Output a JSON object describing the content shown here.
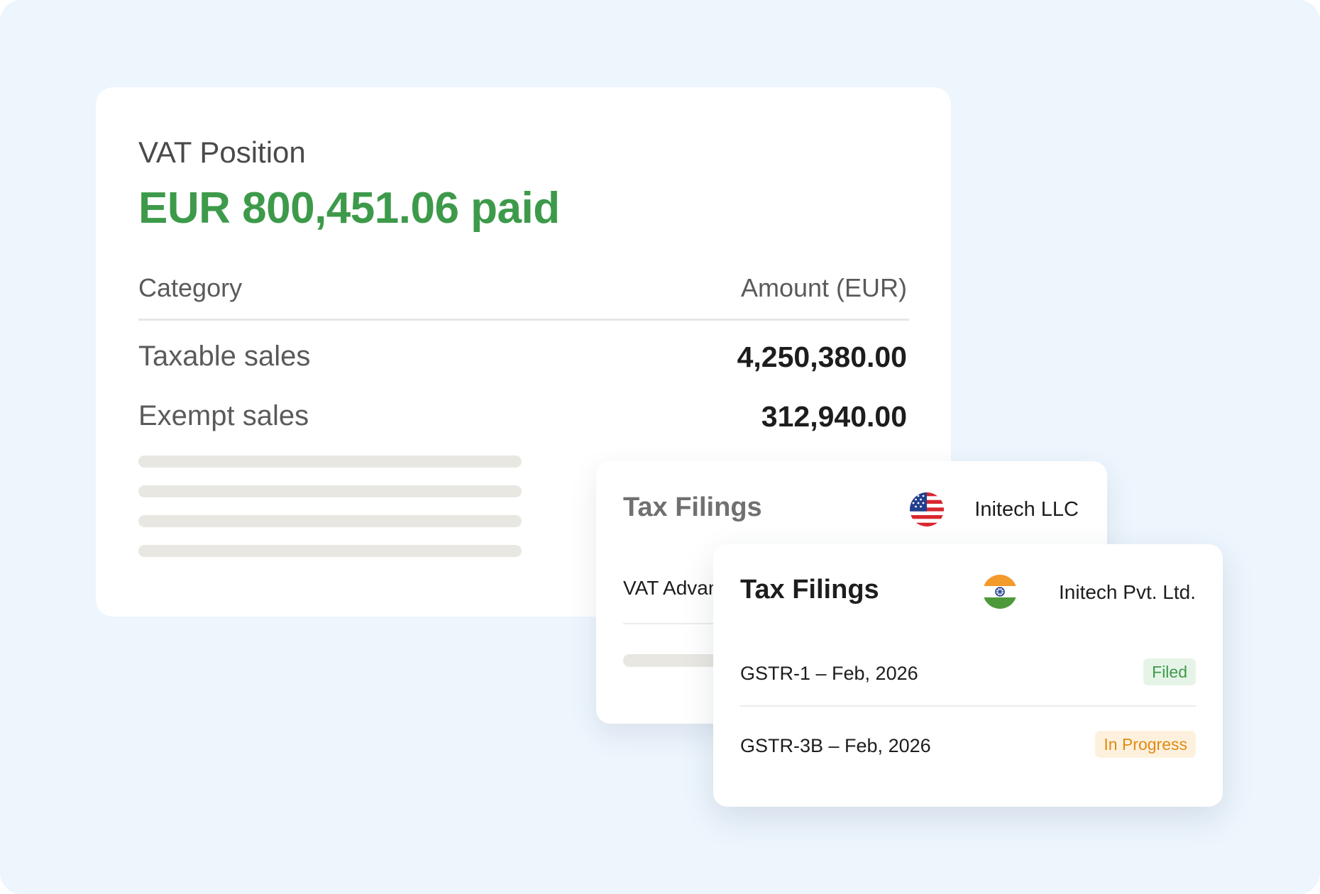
{
  "vat_card": {
    "title": "VAT Position",
    "amount_text": "EUR 800,451.06 paid",
    "amount_color": "#3d9a4a",
    "headers": {
      "category": "Category",
      "amount": "Amount (EUR)"
    },
    "rows": [
      {
        "category": "Taxable sales",
        "amount": "4,250,380.00"
      },
      {
        "category": "Exempt sales",
        "amount": "312,940.00"
      }
    ]
  },
  "filings_back": {
    "title": "Tax Filings",
    "entity": {
      "name": "Initech LLC",
      "flag_icon": "us-flag-icon"
    },
    "rows": [
      {
        "label": "VAT Advance Return"
      }
    ]
  },
  "filings_front": {
    "title": "Tax Filings",
    "entity": {
      "name": "Initech Pvt. Ltd.",
      "flag_icon": "india-flag-icon"
    },
    "rows": [
      {
        "label": "GSTR-1 – Feb, 2026",
        "status": "Filed",
        "status_color": "#3d9a4a"
      },
      {
        "label": "GSTR-3B – Feb, 2026",
        "status": "In Progress",
        "status_color": "#e08a12"
      }
    ]
  }
}
